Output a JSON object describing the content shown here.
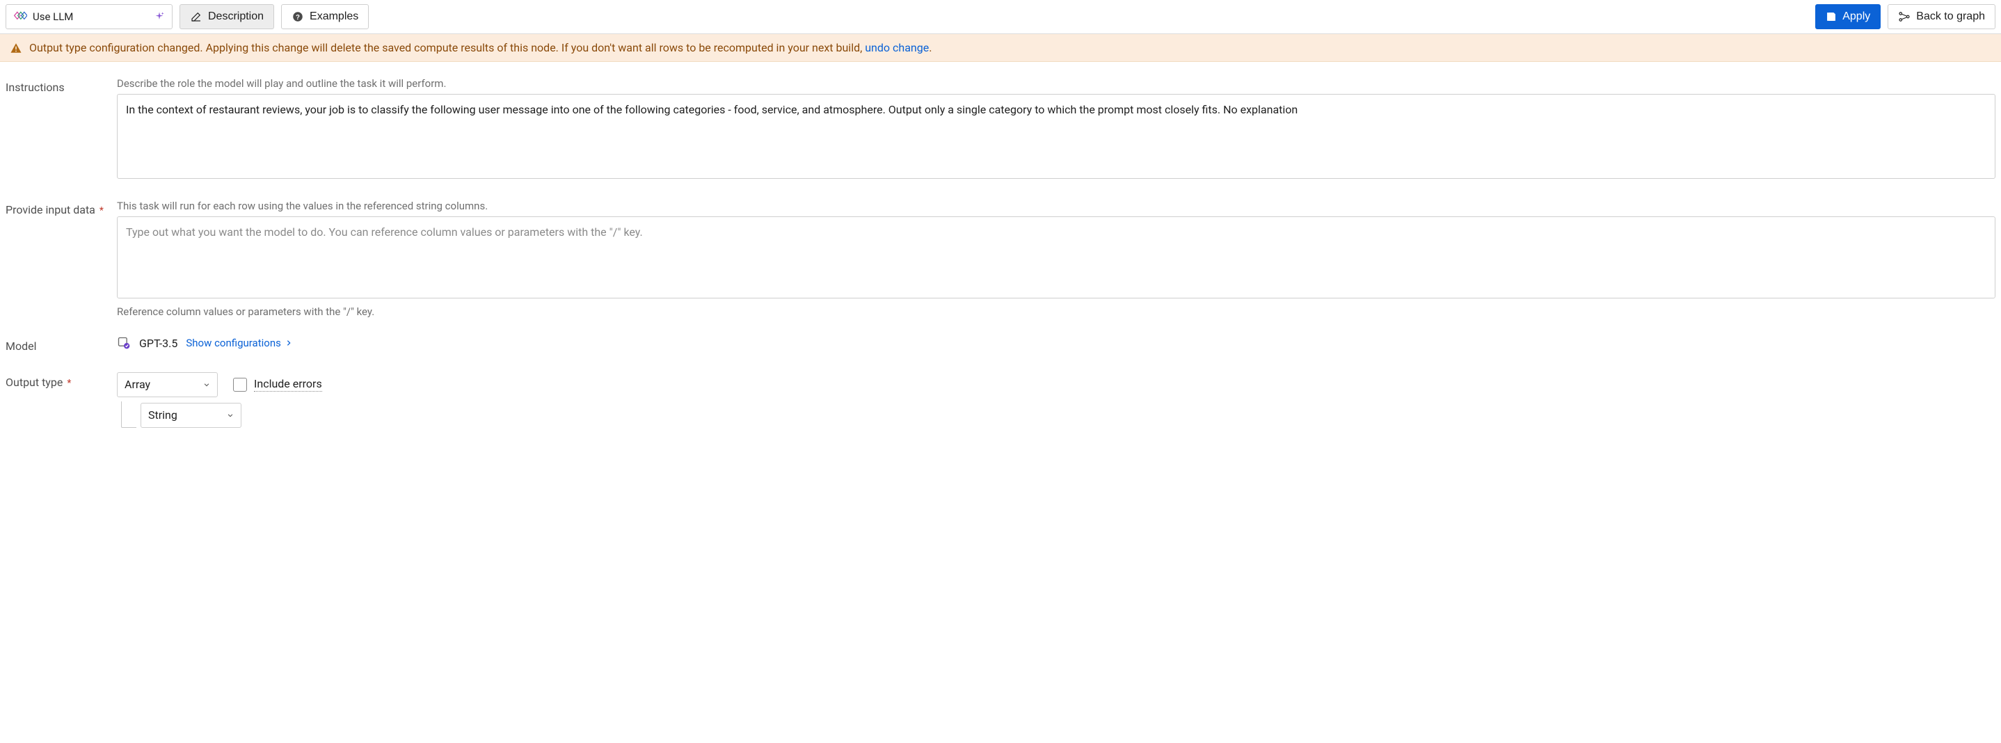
{
  "toolbar": {
    "node_title": "Use LLM",
    "description_btn": "Description",
    "examples_btn": "Examples",
    "apply_btn": "Apply",
    "back_btn": "Back to graph"
  },
  "banner": {
    "text_before_link": "Output type configuration changed. Applying this change will delete the saved compute results of this node. If you don't want all rows to be recomputed in your next build, ",
    "link_text": "undo change",
    "text_after_link": "."
  },
  "form": {
    "instructions": {
      "label": "Instructions",
      "helper": "Describe the role the model will play and outline the task it will perform.",
      "value": "In the context of restaurant reviews, your job is to classify the following user message into one of the following categories - food, service, and atmosphere. Output only a single category to which the prompt most closely fits. No explanation"
    },
    "input_data": {
      "label": "Provide input data",
      "helper": "This task will run for each row using the values in the referenced string columns.",
      "placeholder": "Type out what you want the model to do. You can reference column values or parameters with the \"/\" key.",
      "value": "",
      "helper_below": "Reference column values or parameters with the \"/\" key."
    },
    "model": {
      "label": "Model",
      "name": "GPT-3.5",
      "show_config": "Show configurations"
    },
    "output": {
      "label": "Output type",
      "outer_select": "Array",
      "inner_select": "String",
      "include_errors": "Include errors"
    }
  }
}
